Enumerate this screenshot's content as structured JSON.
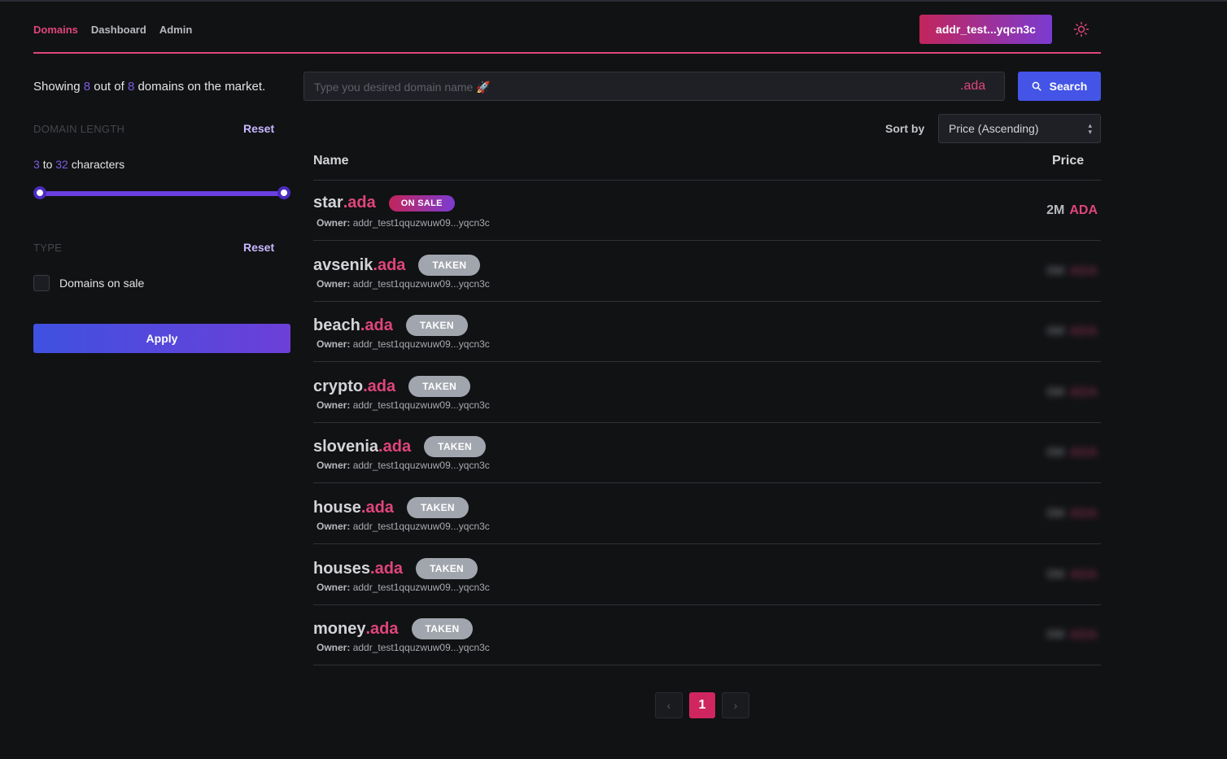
{
  "nav": {
    "links": [
      "Domains",
      "Dashboard",
      "Admin"
    ],
    "wallet_label": "addr_test...yqcn3c",
    "theme_icon": "sun-icon"
  },
  "summary": {
    "prefix": "Showing",
    "shown": "8",
    "middle": "out of",
    "total": "8",
    "suffix": "domains on the market."
  },
  "filters": {
    "length": {
      "title": "DOMAIN LENGTH",
      "reset": "Reset",
      "min": "3",
      "to": "to",
      "max": "32",
      "unit": "characters"
    },
    "type": {
      "title": "TYPE",
      "reset": "Reset",
      "option": "Domains on sale",
      "checked": false
    },
    "apply_label": "Apply"
  },
  "search": {
    "placeholder": "Type you desired domain name 🚀",
    "value": "",
    "suffix": ".ada",
    "button_label": "Search"
  },
  "sort": {
    "label": "Sort by",
    "selected": "Price (Ascending)"
  },
  "table": {
    "headers": {
      "name": "Name",
      "price": "Price"
    },
    "owner_label": "Owner:",
    "rows": [
      {
        "name": "star",
        "tld": ".ada",
        "status": "ON SALE",
        "owner": "addr_test1qquzwuw09...yqcn3c",
        "price": "2M",
        "currency": "ADA"
      },
      {
        "name": "avsenik",
        "tld": ".ada",
        "status": "TAKEN",
        "owner": "addr_test1qquzwuw09...yqcn3c",
        "price": "0M",
        "currency": "ADA"
      },
      {
        "name": "beach",
        "tld": ".ada",
        "status": "TAKEN",
        "owner": "addr_test1qquzwuw09...yqcn3c",
        "price": "0M",
        "currency": "ADA"
      },
      {
        "name": "crypto",
        "tld": ".ada",
        "status": "TAKEN",
        "owner": "addr_test1qquzwuw09...yqcn3c",
        "price": "0M",
        "currency": "ADA"
      },
      {
        "name": "slovenia",
        "tld": ".ada",
        "status": "TAKEN",
        "owner": "addr_test1qquzwuw09...yqcn3c",
        "price": "0M",
        "currency": "ADA"
      },
      {
        "name": "house",
        "tld": ".ada",
        "status": "TAKEN",
        "owner": "addr_test1qquzwuw09...yqcn3c",
        "price": "0M",
        "currency": "ADA"
      },
      {
        "name": "houses",
        "tld": ".ada",
        "status": "TAKEN",
        "owner": "addr_test1qquzwuw09...yqcn3c",
        "price": "0M",
        "currency": "ADA"
      },
      {
        "name": "money",
        "tld": ".ada",
        "status": "TAKEN",
        "owner": "addr_test1qquzwuw09...yqcn3c",
        "price": "0M",
        "currency": "ADA"
      }
    ]
  },
  "pagination": {
    "prev_icon": "chevron-left-icon",
    "current": "1",
    "next_icon": "chevron-right-icon"
  },
  "colors": {
    "accent": "#e0457b",
    "primary": "#4354e6",
    "background": "#111214"
  }
}
